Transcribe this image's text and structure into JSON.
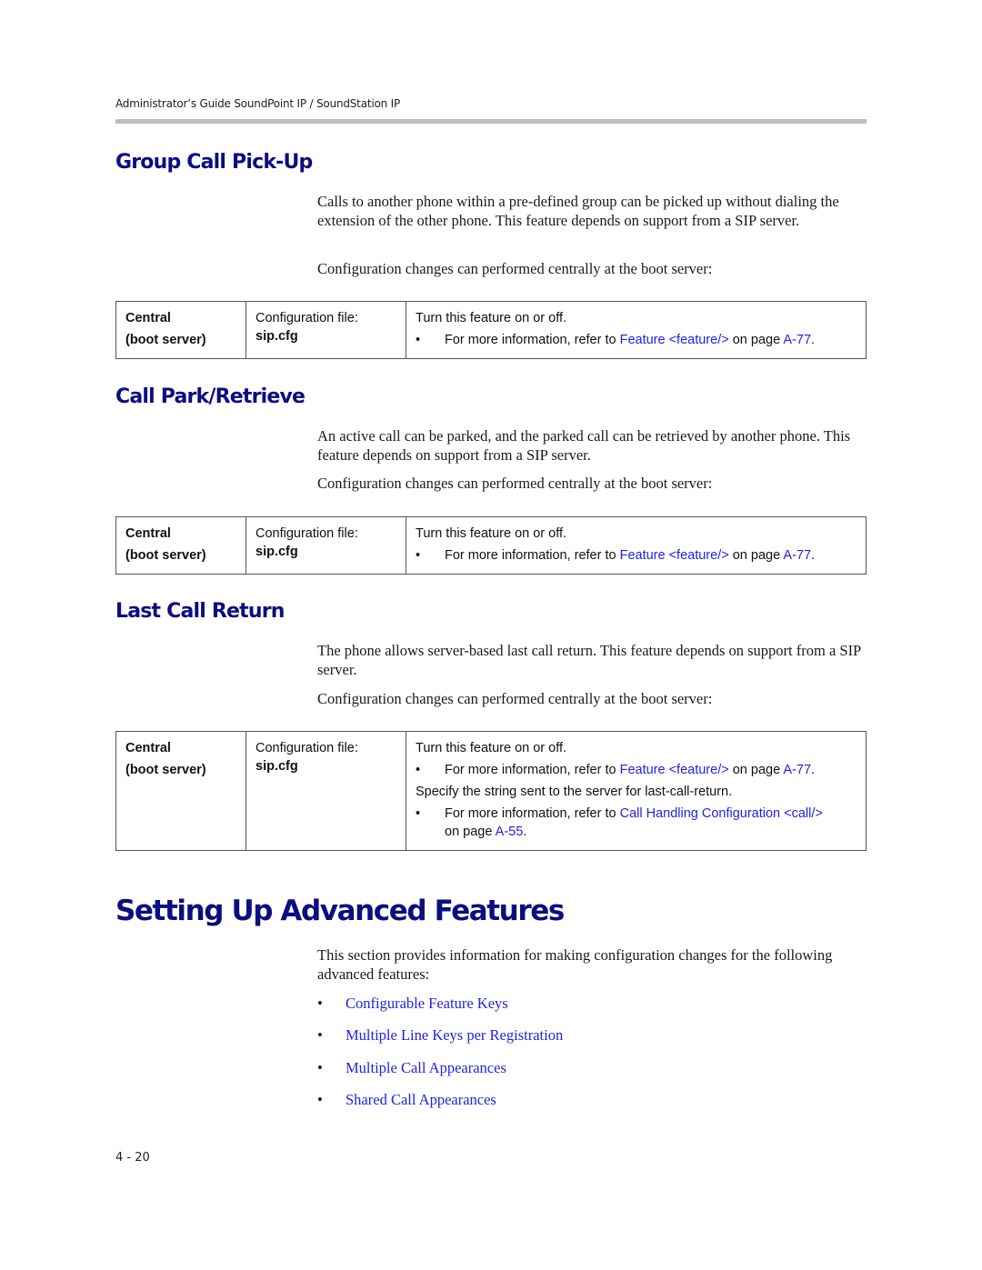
{
  "running_header": "Administrator’s Guide SoundPoint IP / SoundStation IP",
  "sections": [
    {
      "title": "Group Call Pick-Up",
      "paragraphs": [
        "Calls to another phone within a pre-defined group can be picked up without dialing the extension of the other phone. This feature depends on support from a SIP server.",
        "Configuration changes can performed centrally at the boot server:"
      ],
      "table": {
        "col1_line1": "Central",
        "col1_line2": "(boot server)",
        "col2_label": "Configuration file:",
        "col2_file": "sip.cfg",
        "rows": [
          {
            "text": "Turn this feature on or off."
          },
          {
            "bullet": "•",
            "prefix": "For more information, refer to ",
            "link": "Feature <feature/>",
            "mid": " on page ",
            "page_link": "A-77",
            "suffix": "."
          }
        ]
      }
    },
    {
      "title": "Call Park/Retrieve",
      "paragraphs": [
        "An active call can be parked, and the parked call can be retrieved by another phone. This feature depends on support from a SIP server.",
        "Configuration changes can performed centrally at the boot server:"
      ],
      "table": {
        "col1_line1": "Central",
        "col1_line2": "(boot server)",
        "col2_label": "Configuration file:",
        "col2_file": "sip.cfg",
        "rows": [
          {
            "text": "Turn this feature on or off."
          },
          {
            "bullet": "•",
            "prefix": "For more information, refer to ",
            "link": "Feature <feature/>",
            "mid": " on page ",
            "page_link": "A-77",
            "suffix": "."
          }
        ]
      }
    },
    {
      "title": "Last Call Return",
      "paragraphs": [
        "The phone allows server-based last call return. This feature depends on support from a SIP server.",
        "Configuration changes can performed centrally at the boot server:"
      ],
      "table": {
        "col1_line1": "Central",
        "col1_line2": "(boot server)",
        "col2_label": "Configuration file:",
        "col2_file": "sip.cfg",
        "rows": [
          {
            "text": "Turn this feature on or off."
          },
          {
            "bullet": "•",
            "prefix": "For more information, refer to ",
            "link": "Feature <feature/>",
            "mid": " on page ",
            "page_link": "A-77",
            "suffix": "."
          },
          {
            "text": "Specify the string sent to the server for last-call-return."
          },
          {
            "bullet": "•",
            "prefix": "For more information, refer to ",
            "link": "Call Handling Configuration <call/>",
            "mid": " on page ",
            "page_link": "A-55",
            "suffix": "."
          }
        ]
      }
    }
  ],
  "advanced": {
    "title": "Setting Up Advanced Features",
    "intro": "This section provides information for making configuration changes for the following advanced features:",
    "bullet": "•",
    "features": [
      "Configurable Feature Keys",
      "Multiple Line Keys per Registration",
      "Multiple Call Appearances",
      "Shared Call Appearances"
    ]
  },
  "page_number": "4 - 20",
  "colors": {
    "heading": "#0b0d80",
    "link": "#1f1fe6",
    "rule": "#bdbdbd"
  }
}
